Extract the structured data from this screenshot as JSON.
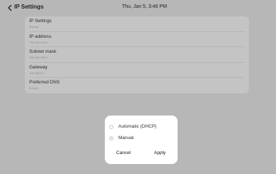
{
  "header": {
    "title": "IP Settings",
    "datetime": "Thu, Jan 5, 3:46 PM"
  },
  "settings": [
    {
      "label": "IP Settings",
      "value": "Manual"
    },
    {
      "label": "IP address",
      "value": "192.168.0.100"
    },
    {
      "label": "Subnet mask",
      "value": "255.255.255.0"
    },
    {
      "label": "Gateway",
      "value": "192.168.0.1"
    },
    {
      "label": "Preferred DNS",
      "value": "8.8.8.8"
    }
  ],
  "dialog": {
    "options": [
      {
        "label": "Automatic (DHCP)",
        "selected": false
      },
      {
        "label": "Manual",
        "selected": true
      }
    ],
    "cancel_label": "Cancel",
    "apply_label": "Apply"
  }
}
